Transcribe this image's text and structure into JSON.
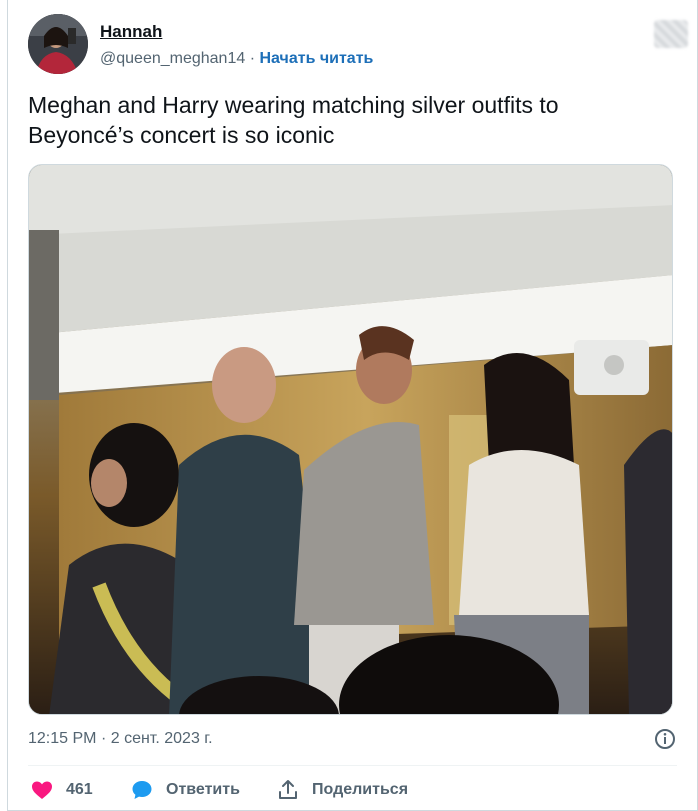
{
  "user": {
    "display_name": "Hannah",
    "handle": "@queen_meghan14",
    "separator": "·",
    "follow_label": "Начать читать"
  },
  "tweet": {
    "text": "Meghan and Harry wearing matching silver outfits to Beyoncé’s concert is so iconic",
    "time": "12:15 PM",
    "date": "2 сент. 2023 г."
  },
  "actions": {
    "like_count": "461",
    "reply_label": "Ответить",
    "share_label": "Поделиться"
  },
  "colors": {
    "like": "#f91880",
    "reply": "#1d9bf0",
    "link": "#1d6fb8",
    "muted": "#536471"
  },
  "icons": {
    "like": "heart-icon",
    "reply": "speech-bubble-icon",
    "share": "share-upload-icon",
    "info": "info-icon",
    "logo": "twitter-logo-icon"
  }
}
